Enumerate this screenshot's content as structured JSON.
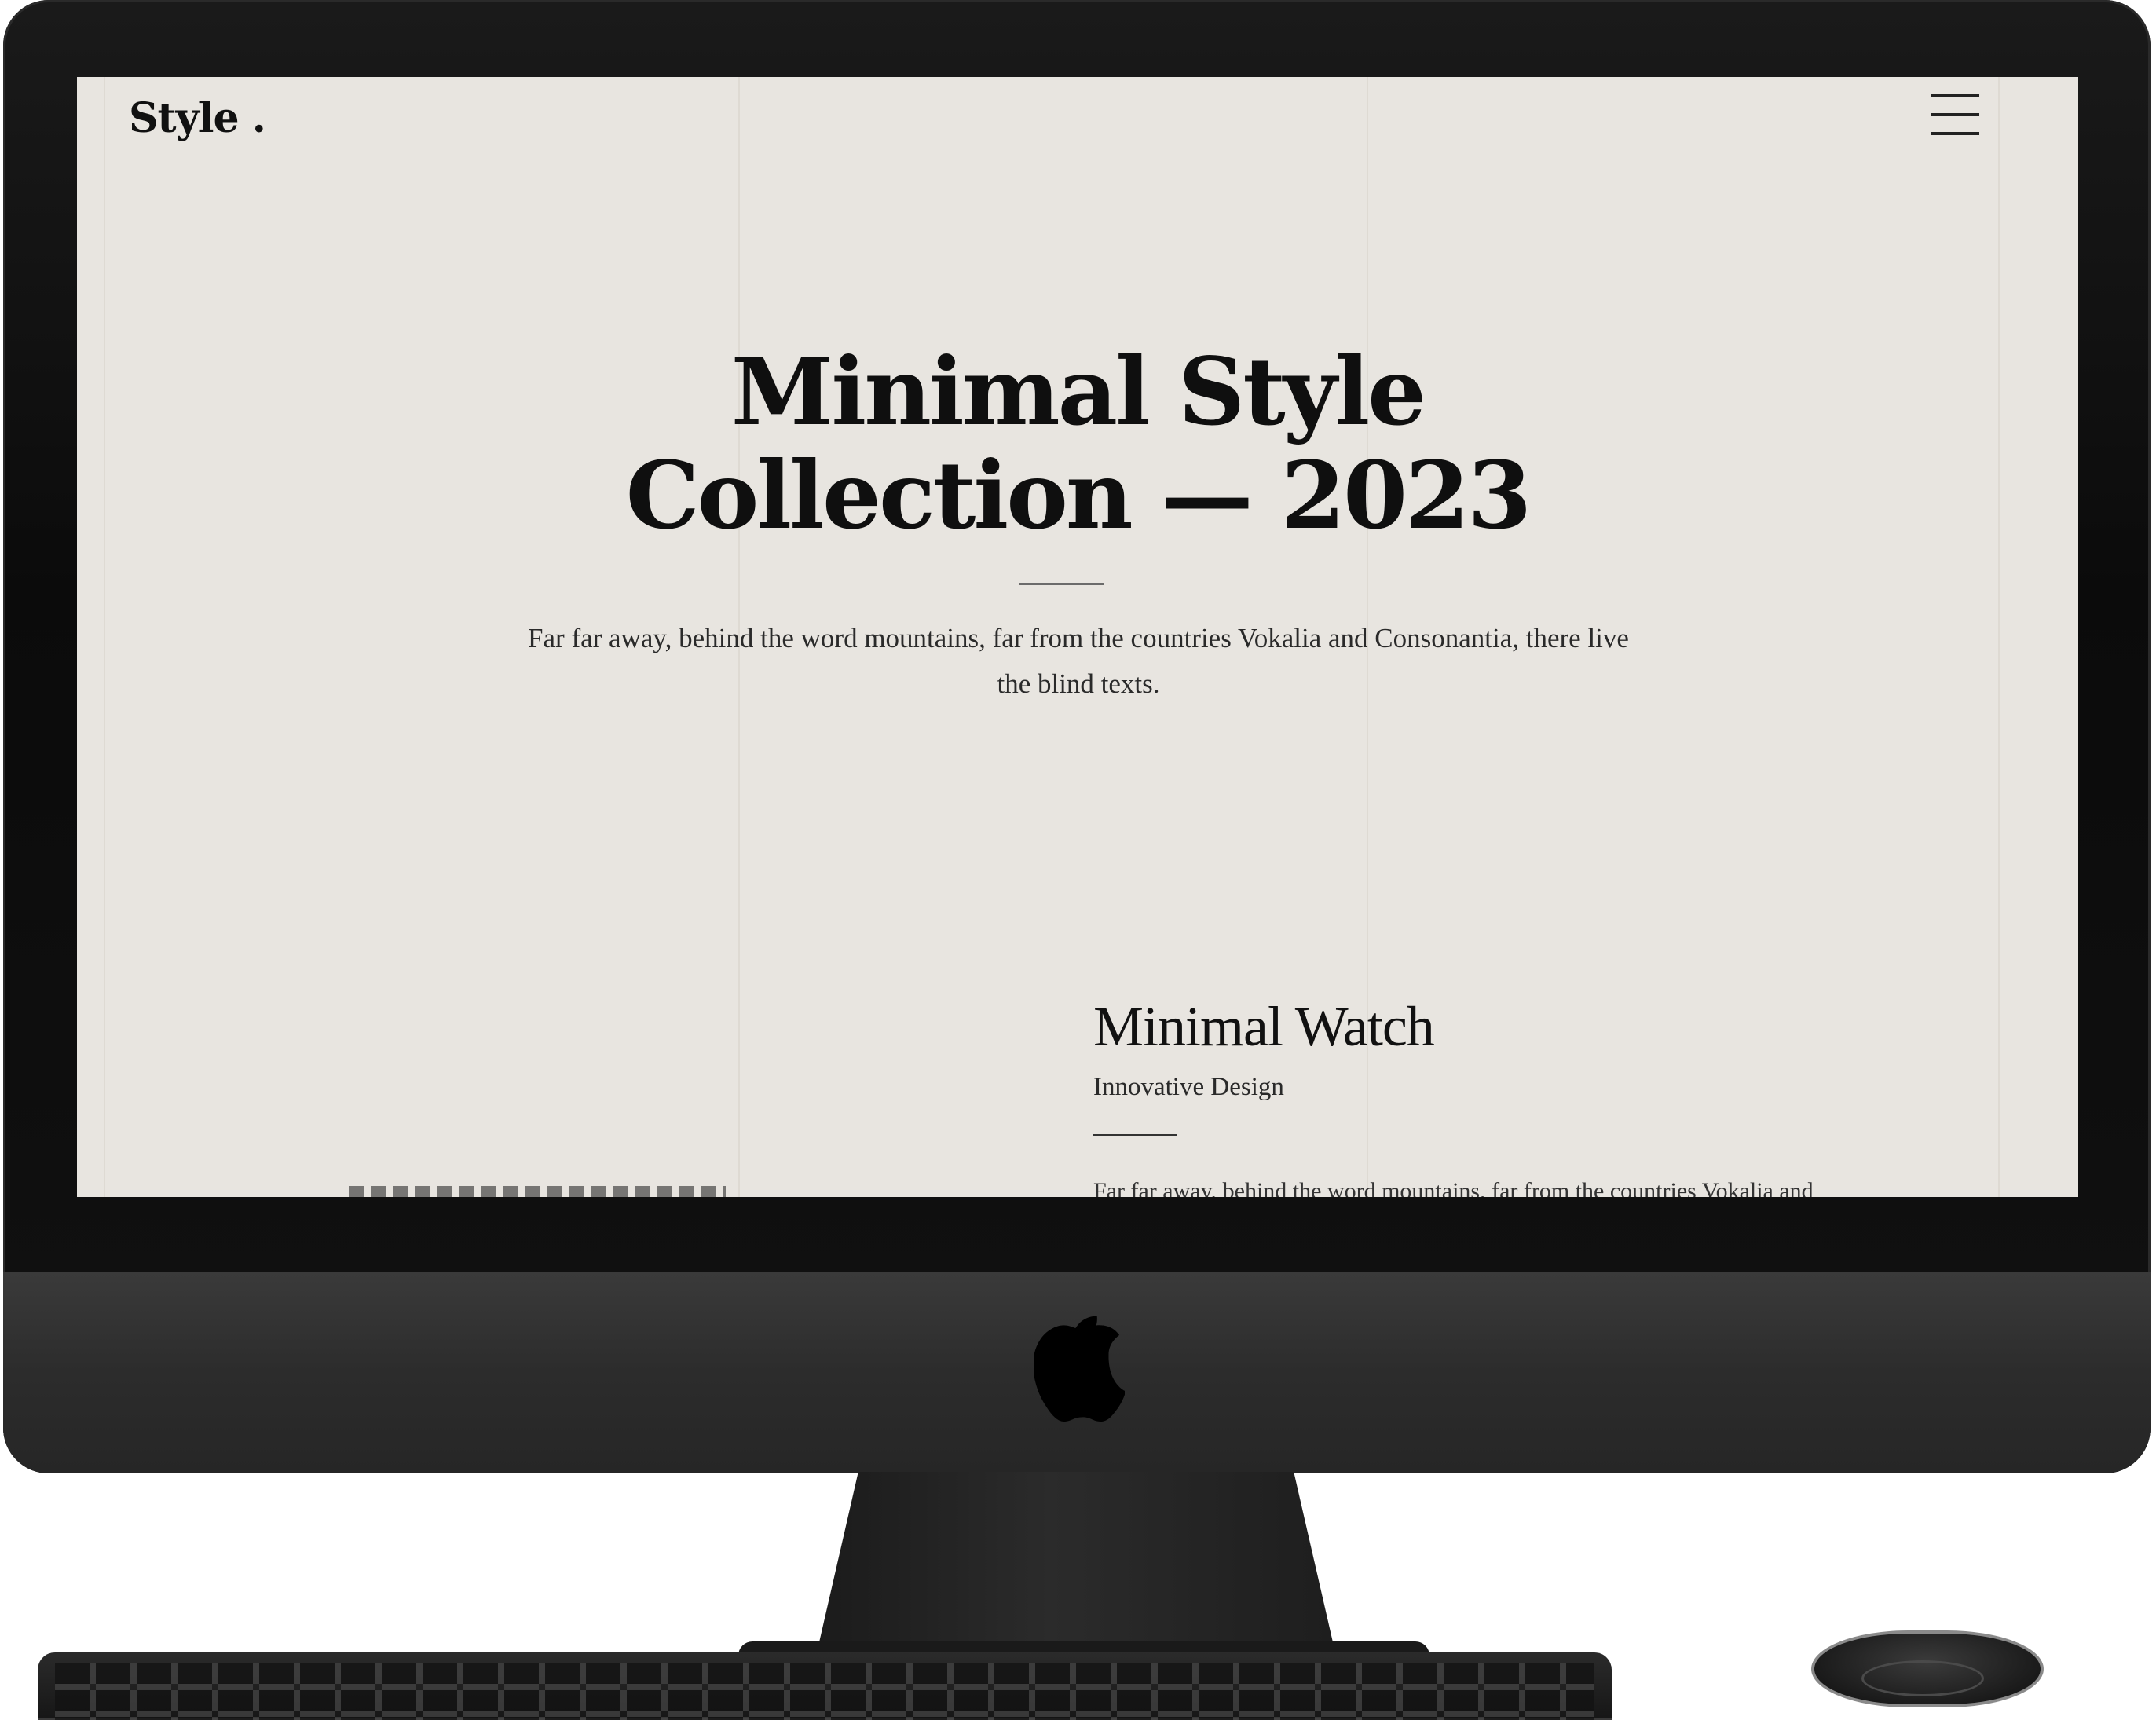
{
  "site": {
    "logo": "Style ."
  },
  "hero": {
    "title_line1": "Minimal Style",
    "title_line2": "Collection — 2023",
    "description": "Far far away, behind the word mountains, far from the countries Vokalia and Consonantia, there live the blind texts."
  },
  "product": {
    "title": "Minimal Watch",
    "subtitle": "Innovative Design",
    "description": "Far far away, behind the word mountains, far from the countries Vokalia and"
  },
  "icons": {
    "menu": "hamburger-menu-icon",
    "device_logo": "apple-logo-icon"
  },
  "colors": {
    "page_background": "#e8e5e0",
    "text": "#111111",
    "device": "#1a1a1a"
  }
}
